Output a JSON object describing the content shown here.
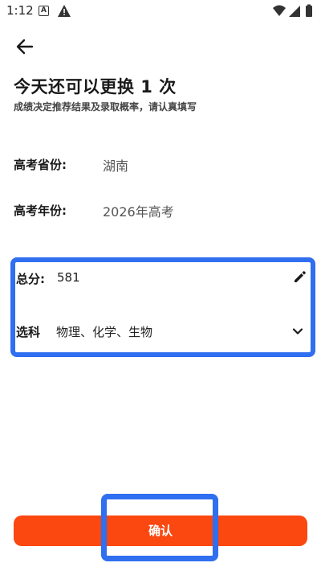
{
  "status_bar": {
    "time": "1:12",
    "a_badge": "A"
  },
  "header": {
    "title": "今天还可以更换 1 次",
    "subtitle": "成绩决定推荐结果及录取概率，请认真填写"
  },
  "form": {
    "province_label": "高考省份:",
    "province_value": "湖南",
    "year_label": "高考年份:",
    "year_value": "2026年高考",
    "score_label": "总分:",
    "score_value": "581",
    "subject_label": "选科",
    "subject_value": "物理、化学、生物"
  },
  "actions": {
    "confirm_label": "确认"
  },
  "colors": {
    "accent_blue": "#2f6ff0",
    "confirm_orange": "#fb4710"
  }
}
